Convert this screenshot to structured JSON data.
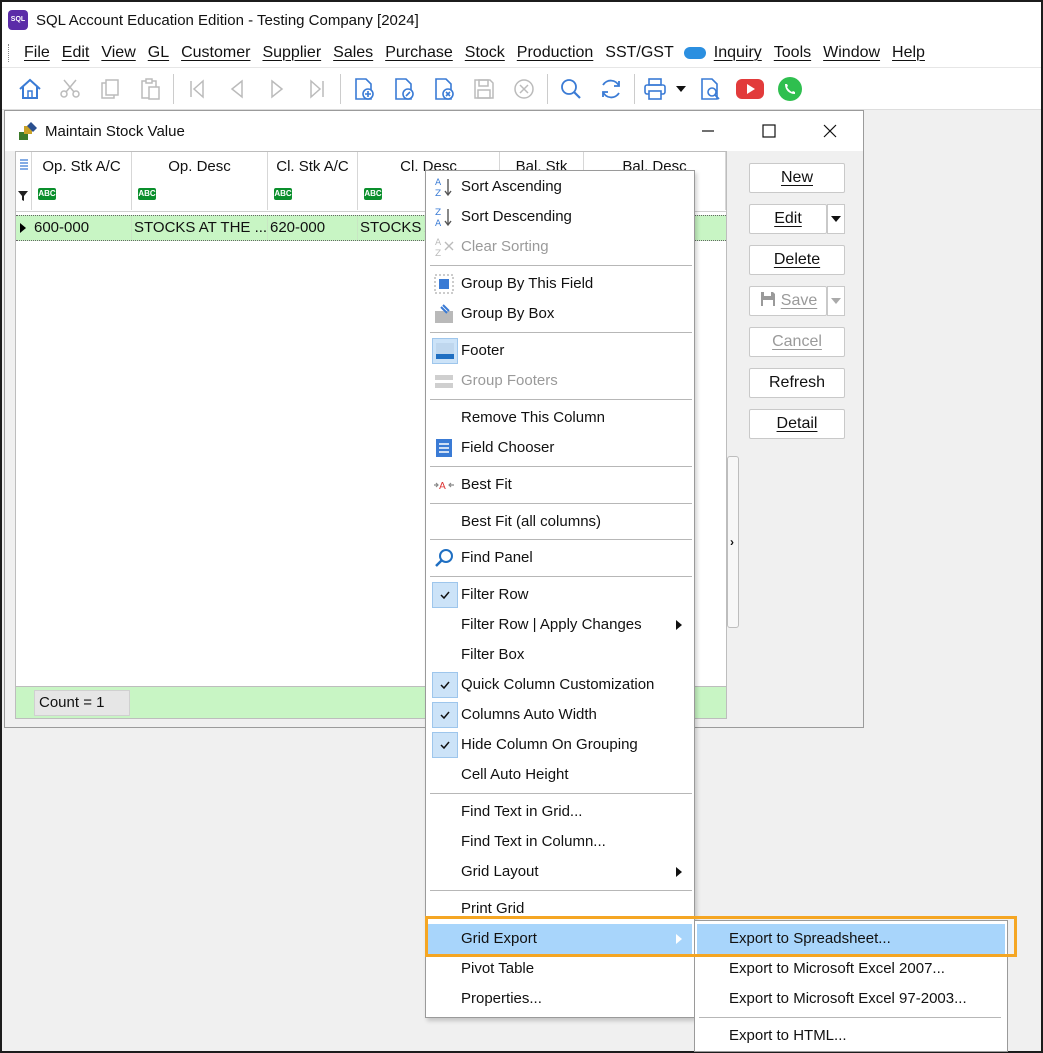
{
  "window": {
    "title": "SQL Account Education Edition - Testing Company [2024]",
    "app_icon": "sql-app-icon",
    "logo_text": "SQL"
  },
  "menubar": {
    "items": [
      "File",
      "Edit",
      "View",
      "GL",
      "Customer",
      "Supplier",
      "Sales",
      "Purchase",
      "Stock",
      "Production",
      "SST/GST",
      "Inquiry",
      "Tools",
      "Window",
      "Help"
    ]
  },
  "toolbar": {
    "icons": [
      "home-icon",
      "cut-icon",
      "copy-icon",
      "paste-icon",
      "first-record-icon",
      "previous-record-icon",
      "next-record-icon",
      "last-record-icon",
      "new-document-icon",
      "edit-document-icon",
      "delete-document-icon",
      "save-icon",
      "cancel-icon",
      "search-icon",
      "refresh-icon",
      "print-icon",
      "print-dropdown-icon",
      "print-preview-icon",
      "youtube-icon",
      "whatsapp-icon"
    ]
  },
  "child_window": {
    "title": "Maintain Stock Value",
    "icon": "stock-value-icon"
  },
  "grid": {
    "columns": [
      "Op. Stk A/C",
      "Op. Desc",
      "Cl. Stk A/C",
      "Cl. Desc",
      "Bal. Stk",
      "Bal. Desc"
    ],
    "filter_badge": "ABC",
    "rows": [
      {
        "op_stk_ac": "600-000",
        "op_desc": "STOCKS AT THE ...",
        "cl_stk_ac": "620-000",
        "cl_desc": "STOCKS A"
      }
    ],
    "footer_count": "Count = 1"
  },
  "side_buttons": {
    "new": "New",
    "edit": "Edit",
    "delete": "Delete",
    "save": "Save",
    "cancel": "Cancel",
    "refresh": "Refresh",
    "detail": "Detail"
  },
  "context_menu": {
    "sort_ascending": "Sort Ascending",
    "sort_descending": "Sort Descending",
    "clear_sorting": "Clear Sorting",
    "group_by_field": "Group By This Field",
    "group_by_box": "Group By Box",
    "footer": "Footer",
    "group_footers": "Group Footers",
    "remove_column": "Remove This Column",
    "field_chooser": "Field Chooser",
    "best_fit": "Best Fit",
    "best_fit_all": "Best Fit (all columns)",
    "find_panel": "Find Panel",
    "filter_row": "Filter Row",
    "filter_row_apply": "Filter Row | Apply Changes",
    "filter_box": "Filter Box",
    "quick_column": "Quick Column Customization",
    "columns_auto_width": "Columns Auto Width",
    "hide_column_grouping": "Hide Column On Grouping",
    "cell_auto_height": "Cell Auto Height",
    "find_text_grid": "Find Text in Grid...",
    "find_text_column": "Find Text in Column...",
    "grid_layout": "Grid Layout",
    "print_grid": "Print Grid",
    "grid_export": "Grid Export",
    "pivot_table": "Pivot Table",
    "properties": "Properties..."
  },
  "submenu": {
    "export_spreadsheet": "Export to Spreadsheet...",
    "export_excel_2007": "Export to Microsoft Excel 2007...",
    "export_excel_97": "Export to Microsoft Excel 97-2003...",
    "export_html": "Export to HTML..."
  },
  "colors": {
    "row_highlight": "#c8f5c4",
    "menu_highlight": "#a8d5fb",
    "callout": "#f5a623",
    "checkbox_bg": "#cce3f8"
  }
}
